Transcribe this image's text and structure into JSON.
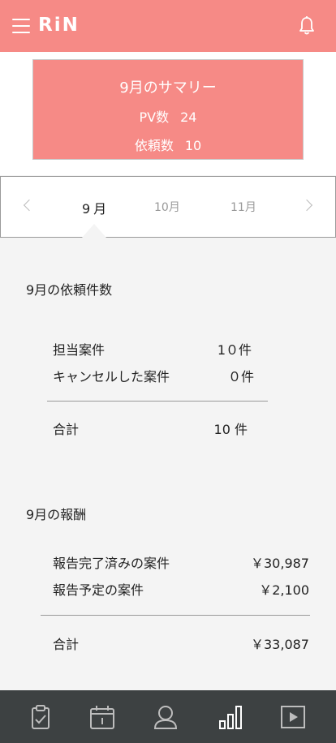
{
  "header": {
    "logo": "RiN",
    "menu_icon": "hamburger-menu-icon",
    "bell_icon": "bell-icon"
  },
  "summary": {
    "title": "9月のサマリー",
    "pv_label": "PV数",
    "pv_value": "24",
    "requests_label": "依頼数",
    "requests_value": "10"
  },
  "month_nav": {
    "current": "9月",
    "next": "10月",
    "after_next": "11月"
  },
  "requests_section": {
    "title": "9月の依頼件数",
    "rows": [
      {
        "label": "担当案件",
        "value": "1０件"
      },
      {
        "label": "キャンセルした案件",
        "value": "０件"
      }
    ],
    "total_label": "合計",
    "total_value": "10 件"
  },
  "reward_section": {
    "title": "9月の報酬",
    "rows": [
      {
        "label": "報告完了済みの案件",
        "value": "￥30,987"
      },
      {
        "label": "報告予定の案件",
        "value": "￥2,100"
      }
    ],
    "total_label": "合計",
    "total_value": "￥33,087"
  },
  "bottom_nav": {
    "items": [
      "clipboard-icon",
      "calendar-icon",
      "person-icon",
      "bar-chart-icon",
      "play-icon"
    ]
  },
  "colors": {
    "brand": "#f68a86",
    "nav_bg": "#3d4142",
    "page_bg": "#f4f4f4"
  }
}
